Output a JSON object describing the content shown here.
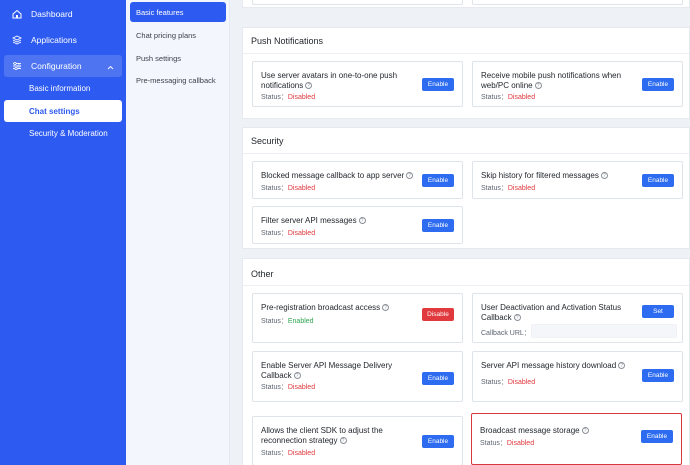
{
  "sidebar": {
    "dashboard": "Dashboard",
    "applications": "Applications",
    "configuration": "Configuration",
    "basic_information": "Basic information",
    "chat_settings": "Chat settings",
    "security_moderation": "Security & Moderation"
  },
  "submenu": {
    "basic_features": "Basic features",
    "chat_pricing_plans": "Chat pricing plans",
    "push_settings": "Push settings",
    "pre_messaging_callback": "Pre-messaging callback"
  },
  "sections": {
    "push": "Push Notifications",
    "security": "Security",
    "other": "Other"
  },
  "labels": {
    "status": "Status：",
    "disabled": "Disabled",
    "enabled": "Enabled",
    "enable": "Enable",
    "disable": "Disable",
    "set": "Set",
    "callback_url": "Callback URL："
  },
  "cards": {
    "server_avatars": "Use server avatars in one-to-one push notifications",
    "mobile_push": "Receive mobile push notifications when web/PC online",
    "blocked_callback": "Blocked message callback to app server",
    "skip_history": "Skip history for filtered messages",
    "filter_api": "Filter server API messages",
    "prereg_broadcast": "Pre-registration broadcast access",
    "user_deactivation": "User Deactivation and Activation Status Callback",
    "delivery_callback": "Enable Server API Message Delivery Callback",
    "history_download": "Server API message history download",
    "reconnection": "Allows the client SDK to adjust the reconnection strategy",
    "broadcast_storage": "Broadcast message storage"
  },
  "colors": {
    "sidebar": "#2d5af0",
    "primary_button": "#2d6cf0",
    "disabled_text": "#e0393e",
    "enabled_text": "#2ea44f",
    "highlight_border": "#d8383f"
  }
}
